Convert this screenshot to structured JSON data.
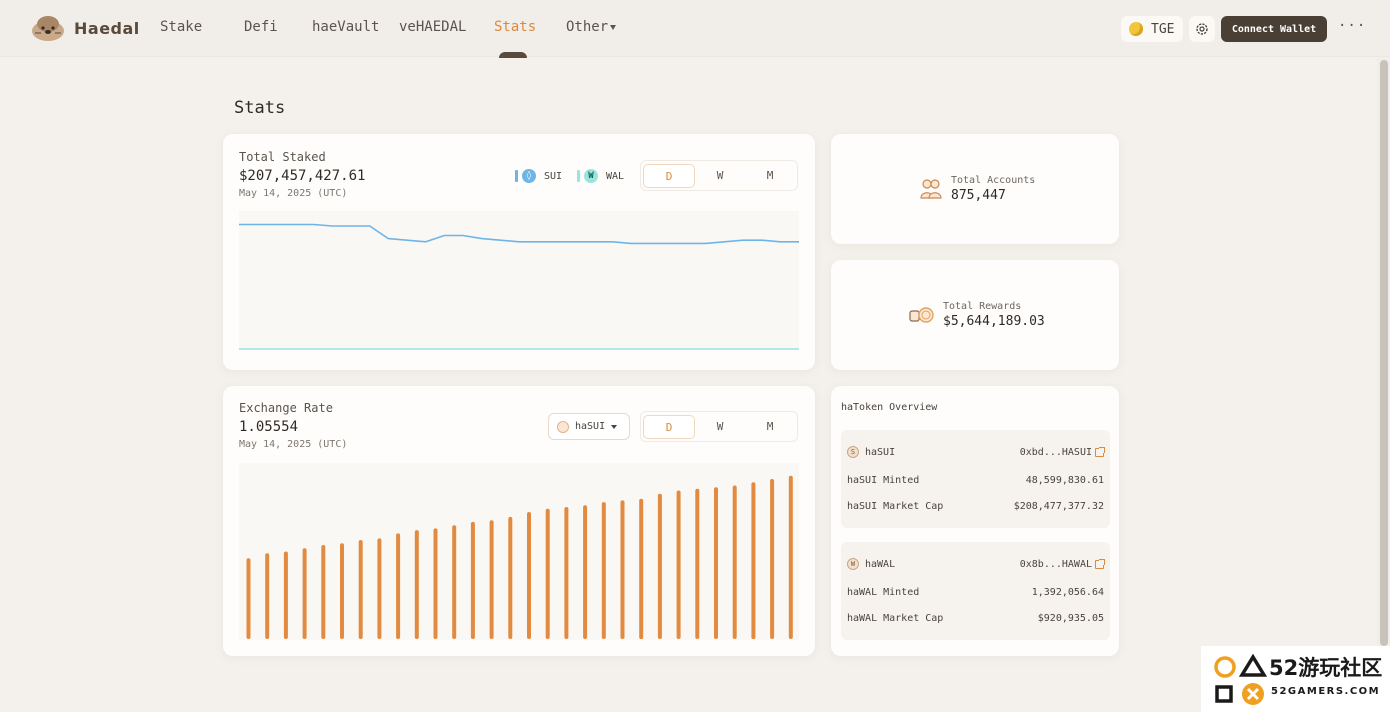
{
  "header": {
    "brand": "Haedal",
    "nav": [
      {
        "label": "Stake"
      },
      {
        "label": "Defi"
      },
      {
        "label": "haeVault"
      },
      {
        "label": "veHAEDAL"
      },
      {
        "label": "Stats",
        "active": true
      },
      {
        "label": "Other"
      }
    ],
    "tge_label": "TGE",
    "connect_label": "Connect Wallet",
    "more_label": "···"
  },
  "page": {
    "title": "Stats"
  },
  "total_staked": {
    "label": "Total Staked",
    "value": "$207,457,427.61",
    "date": "May 14, 2025 (UTC)",
    "legend": [
      {
        "name": "SUI",
        "color": "#6fb4e6",
        "icon": "sui-icon"
      },
      {
        "name": "WAL",
        "color": "#97e6de",
        "icon": "wal-icon"
      }
    ],
    "periods": [
      "D",
      "W",
      "M"
    ],
    "active_period": "D"
  },
  "exchange_rate": {
    "label": "Exchange Rate",
    "value": "1.05554",
    "date": "May 14, 2025 (UTC)",
    "token": "haSUI",
    "periods": [
      "D",
      "W",
      "M"
    ],
    "active_period": "D"
  },
  "accounts": {
    "label": "Total Accounts",
    "value": "875,447"
  },
  "rewards": {
    "label": "Total Rewards",
    "value": "$5,644,189.03"
  },
  "overview": {
    "title": "haToken Overview",
    "tokens": [
      {
        "name": "haSUI",
        "address": "0xbd...HASUI",
        "icon_letter": "S",
        "minted_label": "haSUI Minted",
        "minted": "48,599,830.61",
        "cap_label": "haSUI Market Cap",
        "cap": "$208,477,377.32"
      },
      {
        "name": "haWAL",
        "address": "0x8b...HAWAL",
        "icon_letter": "W",
        "minted_label": "haWAL Minted",
        "minted": "1,392,056.64",
        "cap_label": "haWAL Market Cap",
        "cap": "$920,935.05"
      }
    ]
  },
  "colors": {
    "accent": "#d98a3e",
    "dark": "#4a3f35",
    "sui_line": "#6fb4e6",
    "wal_line": "#97e6de",
    "bar": "#e28a3f"
  },
  "chart_data": [
    {
      "type": "line",
      "title": "Total Staked",
      "series": [
        {
          "name": "SUI",
          "values": [
            0.79,
            0.79,
            0.79,
            0.79,
            0.79,
            0.78,
            0.78,
            0.78,
            0.7,
            0.69,
            0.68,
            0.72,
            0.72,
            0.7,
            0.69,
            0.68,
            0.68,
            0.68,
            0.68,
            0.68,
            0.68,
            0.67,
            0.67,
            0.67,
            0.67,
            0.67,
            0.68,
            0.69,
            0.69,
            0.68,
            0.68
          ]
        },
        {
          "name": "WAL",
          "values": [
            0.0,
            0.0,
            0.0,
            0.0,
            0.0,
            0.0,
            0.0,
            0.0,
            0.0,
            0.0,
            0.0,
            0.0,
            0.0,
            0.0,
            0.0,
            0.0,
            0.0,
            0.0,
            0.0,
            0.0,
            0.0,
            0.0,
            0.0,
            0.0,
            0.0,
            0.0,
            0.0,
            0.0,
            0.0,
            0.0,
            0.0
          ]
        }
      ],
      "grid": false
    },
    {
      "type": "bar",
      "title": "Exchange Rate",
      "values": [
        0.49,
        0.52,
        0.53,
        0.55,
        0.57,
        0.58,
        0.6,
        0.61,
        0.64,
        0.66,
        0.67,
        0.69,
        0.71,
        0.72,
        0.74,
        0.77,
        0.79,
        0.8,
        0.81,
        0.83,
        0.84,
        0.85,
        0.88,
        0.9,
        0.91,
        0.92,
        0.93,
        0.95,
        0.97,
        0.99
      ],
      "grid": false
    }
  ]
}
